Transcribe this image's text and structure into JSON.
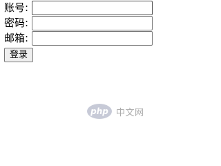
{
  "form": {
    "fields": [
      {
        "label": "账号:",
        "value": ""
      },
      {
        "label": "密码:",
        "value": ""
      },
      {
        "label": "邮箱:",
        "value": ""
      }
    ],
    "submit_label": "登录"
  },
  "watermark": {
    "logo_text": "php",
    "site_text": "中文网"
  }
}
